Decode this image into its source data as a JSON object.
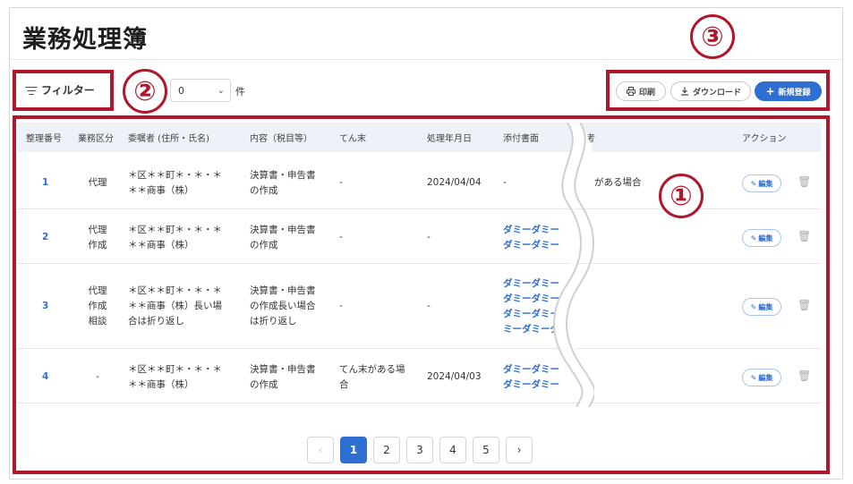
{
  "page": {
    "title": "業務処理簿"
  },
  "toolbar": {
    "filter_label": "フィルター",
    "perpage_value": "0",
    "perpage_unit": "件",
    "print_label": "印刷",
    "download_label": "ダウンロード",
    "new_label": "新規登録"
  },
  "callouts": [
    "①",
    "②",
    "③"
  ],
  "table": {
    "headers": [
      "整理番号",
      "業務区分",
      "委嘱者 (住所・氏名)",
      "内容（税目等）",
      "てん末",
      "処理年月日",
      "添付書面",
      "考",
      "アクション"
    ],
    "rows": [
      {
        "no": "1",
        "kubun": [
          "代理"
        ],
        "itakusha": [
          "＊区＊＊町＊・＊・＊",
          "＊＊商事（株）"
        ],
        "naiyo": [
          "決算書・申告書",
          "の作成"
        ],
        "tenmatsu": [
          "-"
        ],
        "date": "2024/04/04",
        "tenpu": [
          "-"
        ],
        "biko": "がある場合",
        "edit": "編集"
      },
      {
        "no": "2",
        "kubun": [
          "代理",
          "作成"
        ],
        "itakusha": [
          "＊区＊＊町＊・＊・＊",
          "＊＊商事（株）"
        ],
        "naiyo": [
          "決算書・申告書",
          "の作成"
        ],
        "tenmatsu": [
          "-"
        ],
        "date": "-",
        "tenpu": [
          "ダミーダミー",
          "ダミーダミー"
        ],
        "biko": "",
        "edit": "編集"
      },
      {
        "no": "3",
        "kubun": [
          "代理",
          "作成",
          "相談"
        ],
        "itakusha": [
          "＊区＊＊町＊・＊・＊",
          "＊＊商事（株）長い場",
          "合は折り返し"
        ],
        "naiyo": [
          "決算書・申告書",
          "の作成長い場合",
          "は折り返し"
        ],
        "tenmatsu": [
          "-"
        ],
        "date": "-",
        "tenpu": [
          "ダミーダミー",
          "ダミーダミー",
          "ダミーダミーダ",
          "ミーダミーダミ"
        ],
        "biko": "",
        "edit": "編集"
      },
      {
        "no": "4",
        "kubun": [
          "-"
        ],
        "itakusha": [
          "＊区＊＊町＊・＊・＊",
          "＊＊商事（株）"
        ],
        "naiyo": [
          "決算書・申告書",
          "の作成"
        ],
        "tenmatsu": [
          "てん末がある場",
          "合"
        ],
        "date": "2024/04/03",
        "tenpu": [
          "ダミーダミー",
          "ダミーダミー"
        ],
        "biko": "",
        "edit": "編集"
      }
    ]
  },
  "pagination": {
    "prev": "‹",
    "pages": [
      "1",
      "2",
      "3",
      "4",
      "5"
    ],
    "next": "›",
    "current": "1"
  },
  "colors": {
    "accent": "#2f6fd1",
    "callout": "#b0162c",
    "header_bg": "#edf2f8"
  },
  "icons": [
    "filter-icon",
    "chevron-down-icon",
    "printer-icon",
    "download-icon",
    "plus-icon",
    "pencil-icon",
    "trash-icon"
  ]
}
